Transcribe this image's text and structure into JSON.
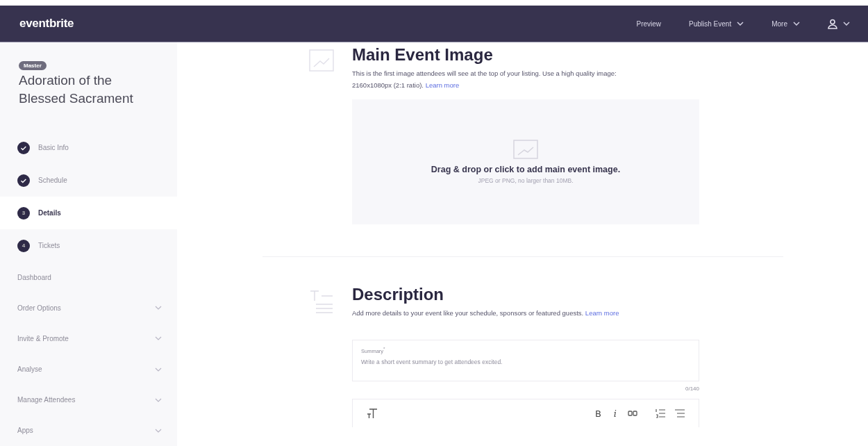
{
  "topbar": {
    "logo": "eventbrite",
    "links": [
      {
        "label": "Preview",
        "dropdown": false
      },
      {
        "label": "Publish Event",
        "dropdown": true
      },
      {
        "label": "More",
        "dropdown": true
      }
    ]
  },
  "sidebar": {
    "badge": "Master",
    "event_title": "Adoration of the Blessed Sacrament",
    "steps": [
      {
        "label": "Basic Info",
        "kind": "done",
        "selected": false
      },
      {
        "label": "Schedule",
        "kind": "done",
        "selected": false
      },
      {
        "label": "Details",
        "kind": "number",
        "number": "3",
        "selected": true
      },
      {
        "label": "Tickets",
        "kind": "number",
        "number": "4",
        "selected": false
      }
    ],
    "nav": [
      {
        "label": "Dashboard",
        "expandable": false
      },
      {
        "label": "Order Options",
        "expandable": true
      },
      {
        "label": "Invite & Promote",
        "expandable": true
      },
      {
        "label": "Analyse",
        "expandable": true
      },
      {
        "label": "Manage Attendees",
        "expandable": true
      },
      {
        "label": "Apps",
        "expandable": true
      }
    ]
  },
  "image_section": {
    "title": "Main Event Image",
    "description": "This is the first image attendees will see at the top of your listing. Use a high quality image: 2160x1080px (2:1 ratio).",
    "link": "Learn more",
    "dropzone": {
      "title": "Drag & drop or click to add main event image.",
      "hint": "JPEG or PNG, no larger than 10MB."
    }
  },
  "description_section": {
    "title": "Description",
    "description": "Add more details to your event like your schedule, sponsors or featured guests.",
    "link": "Learn more",
    "summary": {
      "label": "Summary",
      "required": "*",
      "placeholder": "Write a short event summary to get attendees excited.",
      "count": "0/140"
    },
    "toolbar": [
      {
        "kind": "text-size"
      },
      {
        "kind": "bold",
        "label": "B"
      },
      {
        "kind": "italic",
        "label": "i"
      },
      {
        "kind": "link"
      },
      {
        "kind": "numbered-list"
      },
      {
        "kind": "bullet-list"
      }
    ]
  }
}
